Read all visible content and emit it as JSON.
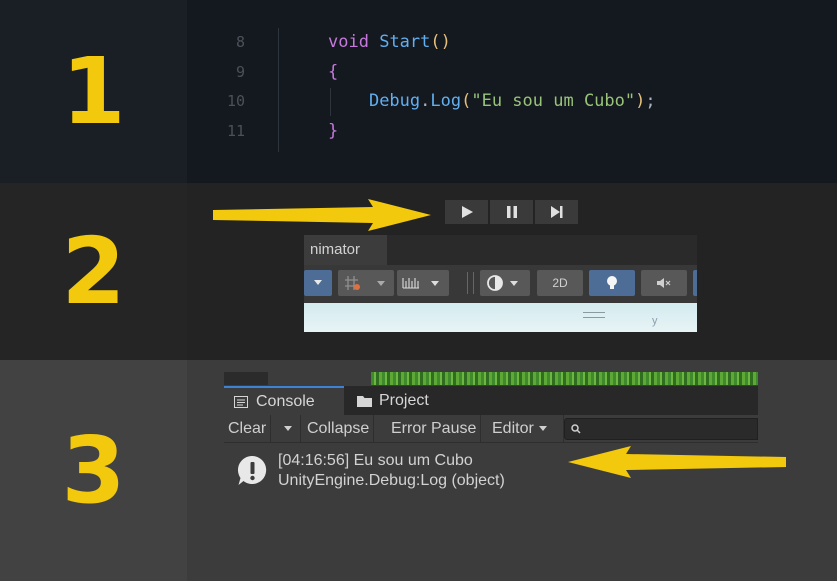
{
  "accent_color": "#f2c90c",
  "steps": [
    {
      "number": "1"
    },
    {
      "number": "2"
    },
    {
      "number": "3"
    }
  ],
  "code": {
    "line_numbers": [
      "8",
      "9",
      "10",
      "11"
    ],
    "line1_keyword": "void",
    "line1_method": "Start",
    "line1_parens": "()",
    "line2": "{",
    "line3_class": "Debug",
    "line3_dot": ".",
    "line3_method": "Log",
    "line3_open": "(",
    "line3_string": "\"Eu sou um Cubo\"",
    "line3_close": ")",
    "line3_semicolon": ";",
    "line4": "}"
  },
  "play_controls": {
    "play_icon": "play-icon",
    "pause_icon": "pause-icon",
    "step_icon": "step-icon"
  },
  "animator": {
    "tab_label": "nimator",
    "mode_2d": "2D"
  },
  "console": {
    "tab_console": "Console",
    "tab_project": "Project",
    "toolbar": {
      "clear": "Clear",
      "collapse": "Collapse",
      "error_pause": "Error Pause",
      "editor": "Editor"
    },
    "log": {
      "line1": "[04:16:56] Eu sou um Cubo",
      "line2": "UnityEngine.Debug:Log (object)"
    }
  }
}
